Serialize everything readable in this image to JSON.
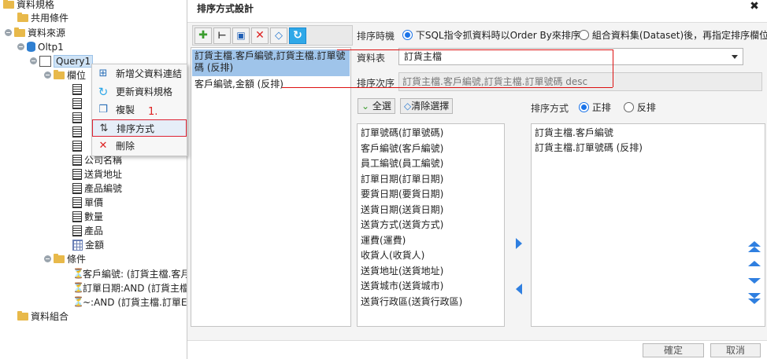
{
  "tree": {
    "root": "資料規格",
    "shared": "共用條件",
    "datasource": "資料來源",
    "oltp": "Oltp1",
    "query": "Query1",
    "fields_folder": "欄位",
    "partial_fields": [
      "公司名稱",
      "送貨地址",
      "產品編號",
      "單價",
      "數量",
      "產品",
      "金額"
    ],
    "conditions_folder": "條件",
    "conditions": [
      "客戶編號: (訂貨主檔.客月",
      "訂單日期:AND (訂貨主檔",
      "~:AND (訂貨主檔.訂單E"
    ],
    "datasets": "資料組合"
  },
  "context_menu": {
    "items": [
      "新增父資料連結",
      "更新資料規格",
      "複製",
      "排序方式",
      "刪除"
    ],
    "annotation": "1."
  },
  "dialog": {
    "title": "排序方式設計",
    "close": "✖",
    "left_items": [
      "訂貨主檔.客戶編號,訂貨主檔.訂單號碼 (反排)",
      "客戶編號,金額 (反排)"
    ],
    "timing_label": "排序時機",
    "timing_opt1": "下SQL指令抓資料時以Order By來排序",
    "timing_opt2": "組合資料集(Dataset)後，再指定排序欄位",
    "table_label": "資料表",
    "table_value": "訂貨主檔",
    "order_label": "排序次序",
    "order_value": "訂貨主檔.客戶編號,訂貨主檔.訂單號碼 desc",
    "select_all": "全選",
    "clear_sel": "清除選擇",
    "sort_mode_label": "排序方式",
    "sort_asc": "正排",
    "sort_desc": "反排",
    "fields": [
      "訂單號碼(訂單號碼)",
      "客戶編號(客戶編號)",
      "員工編號(員工編號)",
      "訂單日期(訂單日期)",
      "要貨日期(要貨日期)",
      "送貨日期(送貨日期)",
      "送貨方式(送貨方式)",
      "運費(運費)",
      "收貨人(收貨人)",
      "送貨地址(送貨地址)",
      "送貨城市(送貨城市)",
      "送貨行政區(送貨行政區)"
    ],
    "sorted": [
      "訂貨主檔.客戶編號",
      "訂貨主檔.訂單號碼 (反排)"
    ],
    "ok": "確定",
    "cancel": "取消"
  },
  "colors": {
    "accent": "#1a73e8",
    "selection": "#9fc4ea",
    "annotation": "#dd2222"
  }
}
